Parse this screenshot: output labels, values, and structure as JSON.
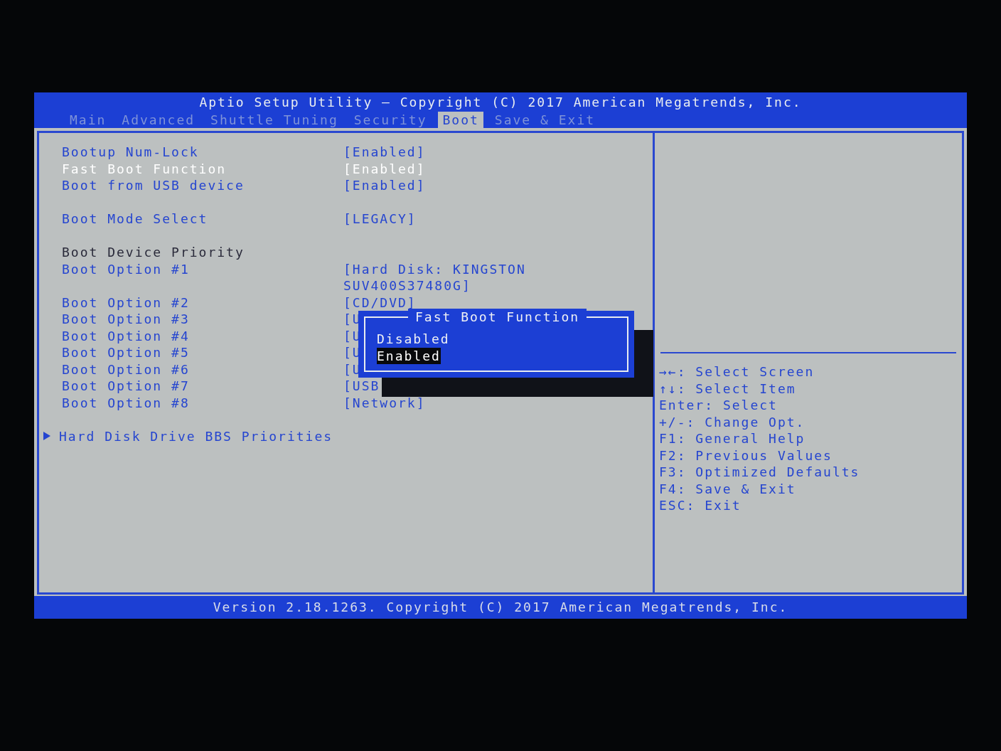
{
  "title": "Aptio Setup Utility – Copyright (C) 2017 American Megatrends, Inc.",
  "tabs": [
    {
      "label": "Main",
      "selected": false
    },
    {
      "label": "Advanced",
      "selected": false
    },
    {
      "label": "Shuttle Tuning",
      "selected": false
    },
    {
      "label": "Security",
      "selected": false
    },
    {
      "label": "Boot",
      "selected": true
    },
    {
      "label": "Save & Exit",
      "selected": false
    }
  ],
  "groups": [
    [
      {
        "kind": "setting",
        "label": "Bootup Num-Lock",
        "value": "[Enabled]",
        "selected": false
      },
      {
        "kind": "setting",
        "label": "Fast Boot Function",
        "value": "[Enabled]",
        "selected": true
      },
      {
        "kind": "setting",
        "label": "Boot from USB device",
        "value": "[Enabled]",
        "selected": false
      }
    ],
    [
      {
        "kind": "setting",
        "label": "Boot Mode Select",
        "value": "[LEGACY]",
        "selected": false
      }
    ],
    [
      {
        "kind": "heading",
        "label": "Boot Device Priority"
      },
      {
        "kind": "setting",
        "label": "Boot Option #1",
        "value": "[Hard Disk: KINGSTON SUV400S37480G]",
        "selected": false
      },
      {
        "kind": "setting",
        "label": "Boot Option #2",
        "value": "[CD/DVD]",
        "selected": false
      },
      {
        "kind": "setting",
        "label": "Boot Option #3",
        "value": "[U",
        "selected": false
      },
      {
        "kind": "setting",
        "label": "Boot Option #4",
        "value": "[U",
        "selected": false
      },
      {
        "kind": "setting",
        "label": "Boot Option #5",
        "value": "[U",
        "selected": false
      },
      {
        "kind": "setting",
        "label": "Boot Option #6",
        "value": "[U",
        "selected": false
      },
      {
        "kind": "setting",
        "label": "Boot Option #7",
        "value": "[USB",
        "selected": false
      },
      {
        "kind": "setting",
        "label": "Boot Option #8",
        "value": "[Network]",
        "selected": false
      }
    ],
    [
      {
        "kind": "submenu",
        "label": "Hard Disk Drive BBS Priorities"
      }
    ]
  ],
  "popup": {
    "title": "Fast Boot Function",
    "options": [
      {
        "label": "Disabled",
        "selected": false
      },
      {
        "label": "Enabled",
        "selected": true
      }
    ]
  },
  "help": [
    {
      "key": "→←:",
      "action": "Select Screen"
    },
    {
      "key": "↑↓:",
      "action": "Select Item"
    },
    {
      "key": "Enter:",
      "action": "Select"
    },
    {
      "key": "+/-:",
      "action": "Change Opt."
    },
    {
      "key": "F1:",
      "action": "General Help"
    },
    {
      "key": "F2:",
      "action": "Previous Values"
    },
    {
      "key": "F3:",
      "action": "Optimized Defaults"
    },
    {
      "key": "F4:",
      "action": "Save & Exit"
    },
    {
      "key": "ESC:",
      "action": "Exit"
    }
  ],
  "footer": "Version 2.18.1263. Copyright (C) 2017 American Megatrends, Inc."
}
